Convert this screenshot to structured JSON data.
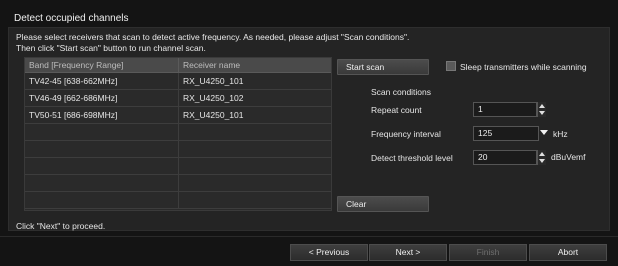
{
  "dialog": {
    "title": "Detect occupied channels",
    "instruction_line1": "Please select receivers that scan to detect active frequency. As needed, please adjust \"Scan conditions\".",
    "instruction_line2": "Then click \"Start scan\" button to run channel scan.",
    "proceed_text": "Click \"Next\" to proceed."
  },
  "table": {
    "headers": [
      "Band [Frequency Range]",
      "Receiver name"
    ],
    "rows": [
      [
        "TV42-45 [638-662MHz]",
        "RX_U4250_101"
      ],
      [
        "TV46-49 [662-686MHz]",
        "RX_U4250_102"
      ],
      [
        "TV50-51 [686-698MHz]",
        "RX_U4250_101"
      ],
      [
        "",
        ""
      ],
      [
        "",
        ""
      ],
      [
        "",
        ""
      ],
      [
        "",
        ""
      ],
      [
        "",
        ""
      ]
    ]
  },
  "scan": {
    "start_label": "Start scan",
    "sleep_label": "Sleep transmitters while scanning",
    "sleep_checked": false,
    "conditions_label": "Scan conditions",
    "repeat_count_label": "Repeat count",
    "repeat_count_value": "1",
    "freq_interval_label": "Frequency interval",
    "freq_interval_value": "125",
    "freq_interval_unit": "kHz",
    "threshold_label": "Detect threshold level",
    "threshold_value": "20",
    "threshold_unit": "dBuVemf",
    "clear_label": "Clear"
  },
  "nav": {
    "previous": "< Previous",
    "next": "Next >",
    "finish": "Finish",
    "abort": "Abort"
  }
}
